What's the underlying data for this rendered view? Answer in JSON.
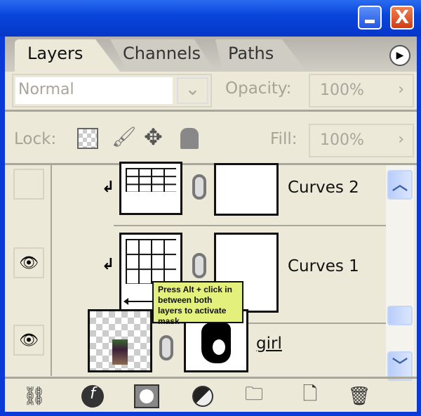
{
  "window": {
    "minimize_label": "_",
    "close_label": "X"
  },
  "tabs": [
    {
      "label": "Layers",
      "active": true
    },
    {
      "label": "Channels",
      "active": false
    },
    {
      "label": "Paths",
      "active": false
    }
  ],
  "panel_menu_icon": "▶",
  "blend_mode": {
    "value": "Normal",
    "dropdown_icon": "⌄"
  },
  "opacity": {
    "label": "Opacity:",
    "value": "100%",
    "arrow": "›"
  },
  "lock": {
    "label": "Lock:",
    "icons": [
      "lock-transparent-icon",
      "lock-paint-icon",
      "lock-move-icon",
      "lock-all-icon"
    ]
  },
  "fill": {
    "label": "Fill:",
    "value": "100%",
    "arrow": "›"
  },
  "layers": [
    {
      "name": "Curves 2",
      "visible": false,
      "clipped": true
    },
    {
      "name": "Curves 1",
      "visible": true,
      "clipped": true
    },
    {
      "name": "girl",
      "visible": true,
      "clipped": false
    }
  ],
  "eye_glyph": "👁",
  "clip_glyph": "↲",
  "tooltip": {
    "text": "Press Alt + click in between both layers to activate mask",
    "color": "#e3f17c"
  },
  "scrollbar": {
    "up": "︿",
    "down": "﹀"
  },
  "colors": {
    "title_bar": "#0a46dc",
    "panel": "#ece9d8"
  }
}
